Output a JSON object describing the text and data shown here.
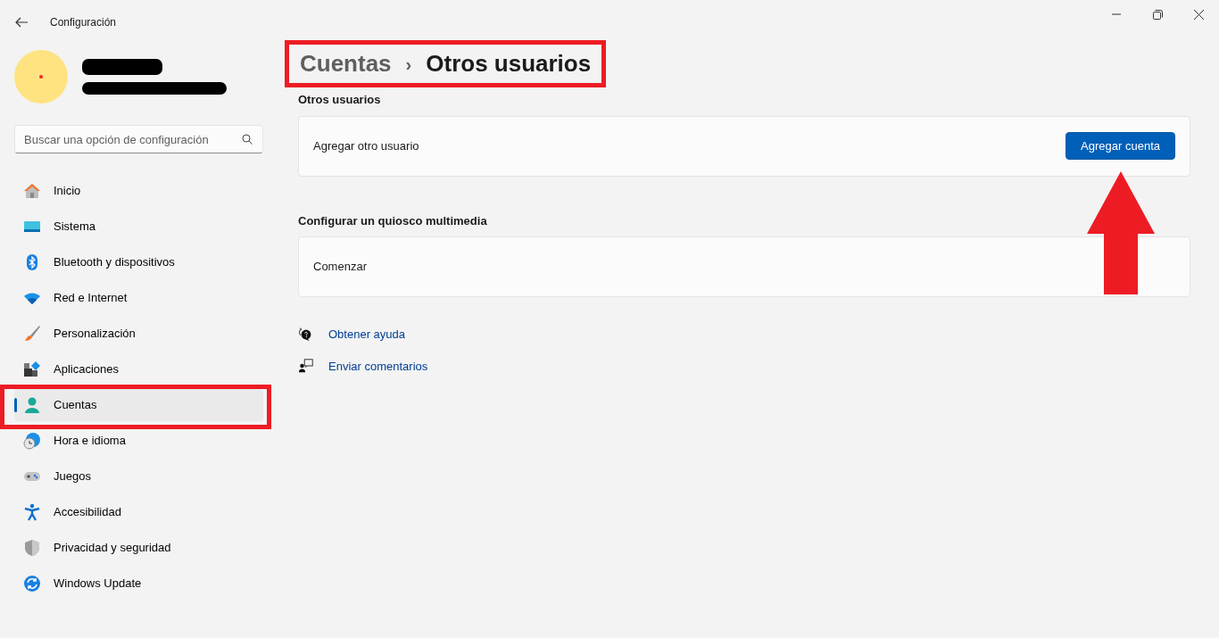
{
  "window": {
    "title": "Configuración"
  },
  "search": {
    "placeholder": "Buscar una opción de configuración"
  },
  "sidebar": {
    "items": [
      {
        "label": "Inicio",
        "selected": false
      },
      {
        "label": "Sistema",
        "selected": false
      },
      {
        "label": "Bluetooth y dispositivos",
        "selected": false
      },
      {
        "label": "Red e Internet",
        "selected": false
      },
      {
        "label": "Personalización",
        "selected": false
      },
      {
        "label": "Aplicaciones",
        "selected": false
      },
      {
        "label": "Cuentas",
        "selected": true
      },
      {
        "label": "Hora e idioma",
        "selected": false
      },
      {
        "label": "Juegos",
        "selected": false
      },
      {
        "label": "Accesibilidad",
        "selected": false
      },
      {
        "label": "Privacidad y seguridad",
        "selected": false
      },
      {
        "label": "Windows Update",
        "selected": false
      }
    ]
  },
  "breadcrumb": {
    "parent": "Cuentas",
    "separator": "›",
    "current": "Otros usuarios"
  },
  "sections": [
    {
      "heading": "Otros usuarios",
      "rows": [
        {
          "label": "Agregar otro usuario",
          "button": "Agregar cuenta"
        }
      ]
    },
    {
      "heading": "Configurar un quiosco multimedia",
      "rows": [
        {
          "label": "Comenzar"
        }
      ]
    }
  ],
  "links": [
    {
      "label": "Obtener ayuda"
    },
    {
      "label": "Enviar comentarios"
    }
  ]
}
